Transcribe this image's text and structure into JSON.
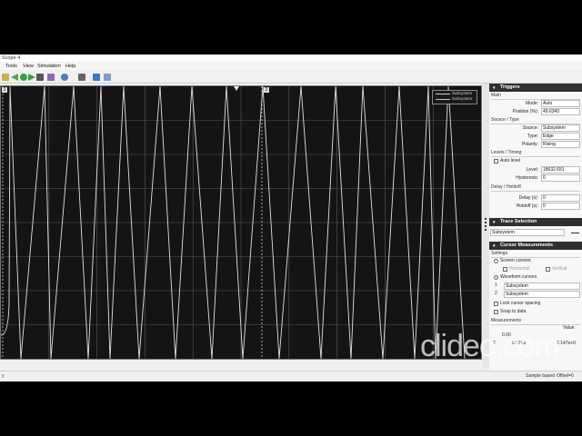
{
  "window": {
    "title": "Scope 4"
  },
  "menu": [
    "Tools",
    "View",
    "Simulation",
    "Help"
  ],
  "scope": {
    "cursor_labels": [
      "1",
      "2"
    ],
    "legend": [
      "Subsystem",
      "Subsystem"
    ],
    "legend_suffix": "[4]",
    "trace_color": "#e0e0e0",
    "grid_color": "#5a5a5a"
  },
  "triggers": {
    "title": "Triggers",
    "main": {
      "title": "Main",
      "mode_label": "Mode:",
      "mode": "Auto",
      "position_label": "Position (%):",
      "position": "49.6343"
    },
    "source_type": {
      "title": "Source / Type",
      "source_label": "Source:",
      "source": "Subsystem",
      "type_label": "Type:",
      "type": "Edge",
      "polarity_label": "Polarity:",
      "polarity": "Rising"
    },
    "levels": {
      "title": "Levels / Timing",
      "auto_level": "Auto level",
      "level_label": "Level:",
      "level": "18632.651",
      "hysteresis_label": "Hysteresis:",
      "hysteresis": "0"
    },
    "delay": {
      "title": "Delay / Holdoff",
      "delay_label": "Delay (s):",
      "delay": "0",
      "holdoff_label": "Holdoff (s):",
      "holdoff": "0"
    }
  },
  "trace_selection": {
    "title": "Trace Selection",
    "value": "Subsystem"
  },
  "cursor_measurements": {
    "title": "Cursor Measurements",
    "settings_title": "Settings",
    "screen_cursors": "Screen cursors",
    "horizontal": "Horizontal",
    "vertical": "Vertical",
    "waveform_cursors": "Waveform cursors",
    "wf_rows": [
      {
        "n": "1",
        "value": "Subsystem"
      },
      {
        "n": "2",
        "value": "Subsystem"
      }
    ],
    "lock_spacing": "Lock cursor spacing",
    "snap": "Snap to data",
    "measurements_title": "Measurements",
    "value_header": "Value",
    "row1_time": "0.00",
    "row2_n": "2",
    "row2_time": "54.953",
    "row2_value": "2.147e+0"
  },
  "status": {
    "left": "y",
    "mode": "Sample based",
    "offset": "Offset=0"
  },
  "watermark": "clideo.com"
}
